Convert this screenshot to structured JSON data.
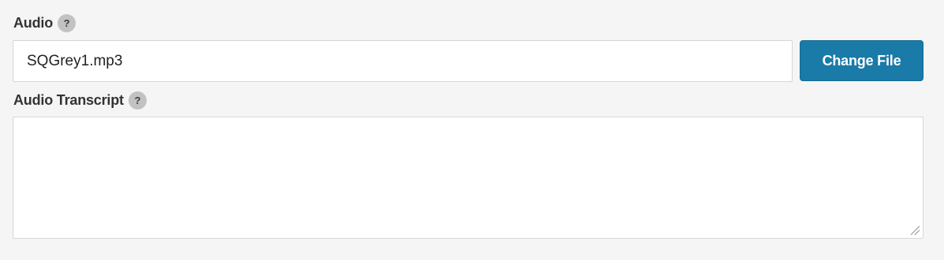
{
  "audio": {
    "label": "Audio",
    "help_glyph": "?",
    "file_name": "SQGrey1.mp3",
    "change_button_label": "Change File"
  },
  "transcript": {
    "label": "Audio Transcript",
    "help_glyph": "?",
    "value": ""
  },
  "colors": {
    "background": "#f5f5f5",
    "button": "#1a7aa8",
    "help_icon_bg": "#c2c2c2",
    "label_text": "#333333"
  },
  "icons": {
    "help": "question-mark-circle-icon",
    "resize": "resize-handle-icon"
  }
}
